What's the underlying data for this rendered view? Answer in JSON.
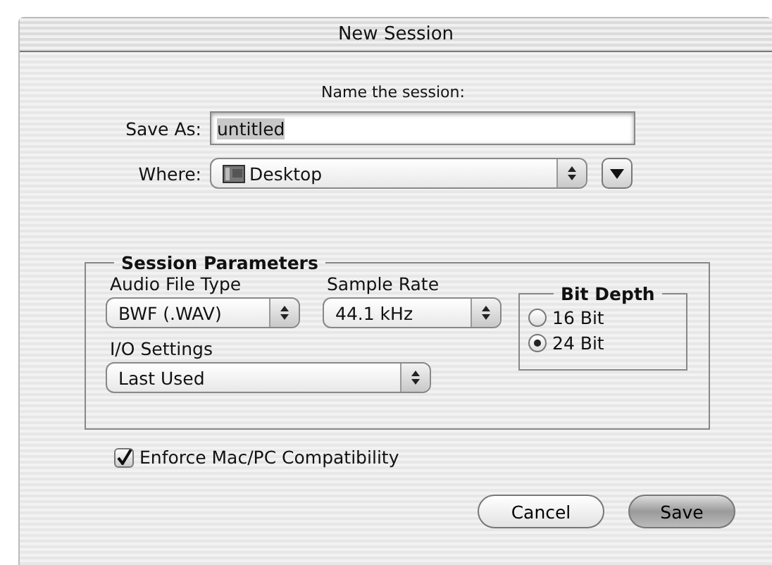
{
  "window": {
    "title": "New Session"
  },
  "prompt": "Name the session:",
  "save_as": {
    "label": "Save As:",
    "value": "untitled",
    "selected": true
  },
  "where": {
    "label": "Where:",
    "value": "Desktop"
  },
  "session_parameters": {
    "title": "Session Parameters",
    "audio_file_type": {
      "label": "Audio File Type",
      "value": "BWF (.WAV)"
    },
    "sample_rate": {
      "label": "Sample Rate",
      "value": "44.1 kHz"
    },
    "io_settings": {
      "label": "I/O Settings",
      "value": "Last Used"
    },
    "bit_depth": {
      "title": "Bit Depth",
      "options": [
        {
          "label": "16 Bit",
          "selected": false
        },
        {
          "label": "24 Bit",
          "selected": true
        }
      ]
    }
  },
  "enforce_compatibility": {
    "label": "Enforce Mac/PC Compatibility",
    "checked": true
  },
  "buttons": [
    {
      "label": "Cancel",
      "default": false
    },
    {
      "label": "Save",
      "default": true
    }
  ]
}
